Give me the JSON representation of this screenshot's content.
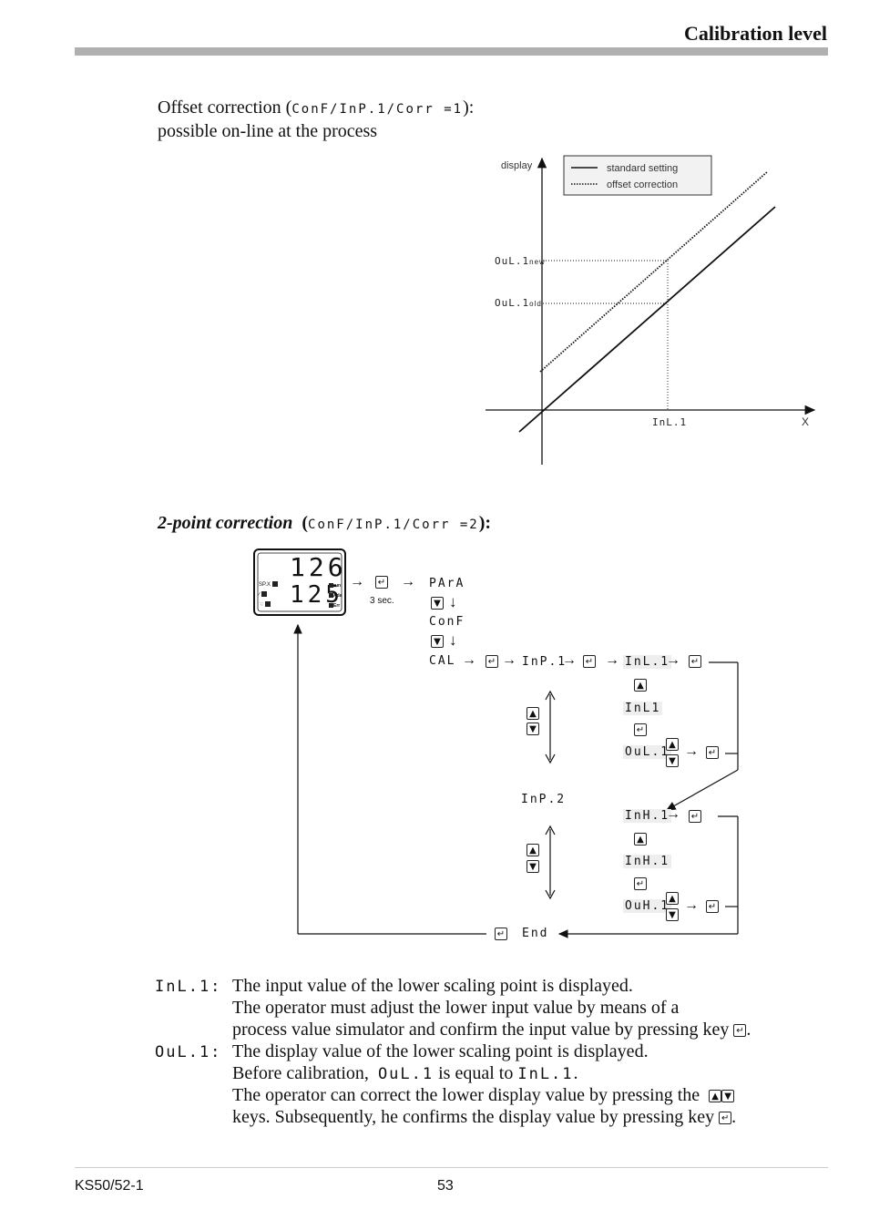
{
  "header": {
    "title": "Calibration level"
  },
  "offset_section": {
    "title_prefix": "Offset correction (",
    "path_code": "ConF/InP.1/Corr =1",
    "title_suffix": "):",
    "subtitle": "possible on-line at the process"
  },
  "offset_chart": {
    "y_axis_label": "display",
    "x_axis_label": "X",
    "legend": [
      {
        "label": "standard setting",
        "style": "solid"
      },
      {
        "label": "offset correction",
        "style": "dotted"
      }
    ],
    "y_marker_new": {
      "code": "OuL.1",
      "sub": "new"
    },
    "y_marker_old": {
      "code": "OuL.1",
      "sub": "old"
    },
    "x_marker": {
      "code": "InL.1"
    }
  },
  "twopoint_section": {
    "title": "2-point correction",
    "path_code": "ConF/InP.1/Corr =2",
    "suffix": "):"
  },
  "device": {
    "upper_value": "126",
    "lower_value": "125",
    "left_leds": [
      "SP.X",
      "ramp",
      "hand"
    ],
    "right_leds": [
      "run",
      "Ada",
      "Err"
    ]
  },
  "flow": {
    "hold_note": "3 sec.",
    "para": "PArA",
    "conf": "ConF",
    "cal": "CAL",
    "inp1": "InP.1",
    "inl1": "InL.1",
    "inl1_adj": "InL1",
    "oul1": "OuL.1",
    "inp2": "InP.2",
    "inh1": "InH.1",
    "inh1_adj": "InH.1",
    "ouh1": "OuH.1",
    "end": "End",
    "icons": {
      "enter": "↵",
      "up": "▲",
      "down": "▼",
      "arrow_right": "→",
      "arrow_down": "↓"
    }
  },
  "descriptions": [
    {
      "term": "InL.1:",
      "lines": [
        "The input value of the lower scaling point is displayed.",
        "The operator must adjust the lower input value by means of a",
        "process value simulator and confirm the input value by pressing key"
      ]
    },
    {
      "term": "OuL.1:",
      "lines": [
        "The display value of the lower scaling point is displayed.",
        "Before calibration,",
        "is equal to",
        "The operator can correct the lower display value by pressing the",
        "keys. Subsequently, he confirms the display value by pressing key"
      ],
      "inline_codes": [
        "OuL.1",
        "InL.1"
      ]
    }
  ],
  "footer": {
    "doc_id": "KS50/52-1",
    "page_number": "53"
  }
}
